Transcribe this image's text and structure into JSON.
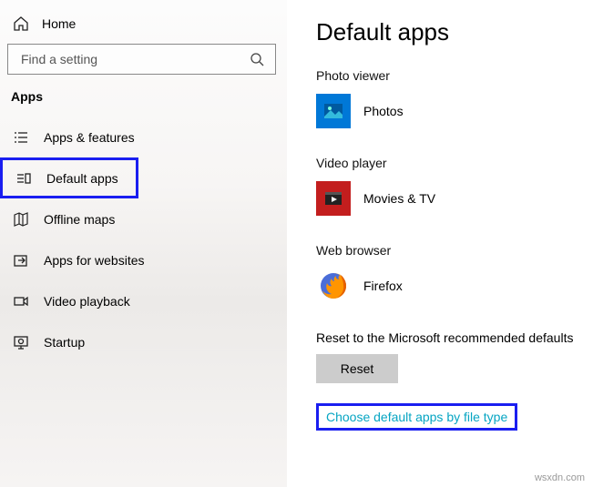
{
  "sidebar": {
    "home_label": "Home",
    "search_placeholder": "Find a setting",
    "section_header": "Apps",
    "items": [
      {
        "label": "Apps & features"
      },
      {
        "label": "Default apps"
      },
      {
        "label": "Offline maps"
      },
      {
        "label": "Apps for websites"
      },
      {
        "label": "Video playback"
      },
      {
        "label": "Startup"
      }
    ]
  },
  "content": {
    "title": "Default apps",
    "sections": {
      "photo_viewer": {
        "label": "Photo viewer",
        "app": "Photos"
      },
      "video_player": {
        "label": "Video player",
        "app": "Movies & TV"
      },
      "web_browser": {
        "label": "Web browser",
        "app": "Firefox"
      }
    },
    "reset_label": "Reset to the Microsoft recommended defaults",
    "reset_button": "Reset",
    "choose_link": "Choose default apps by file type"
  },
  "watermark": "wsxdn.com"
}
